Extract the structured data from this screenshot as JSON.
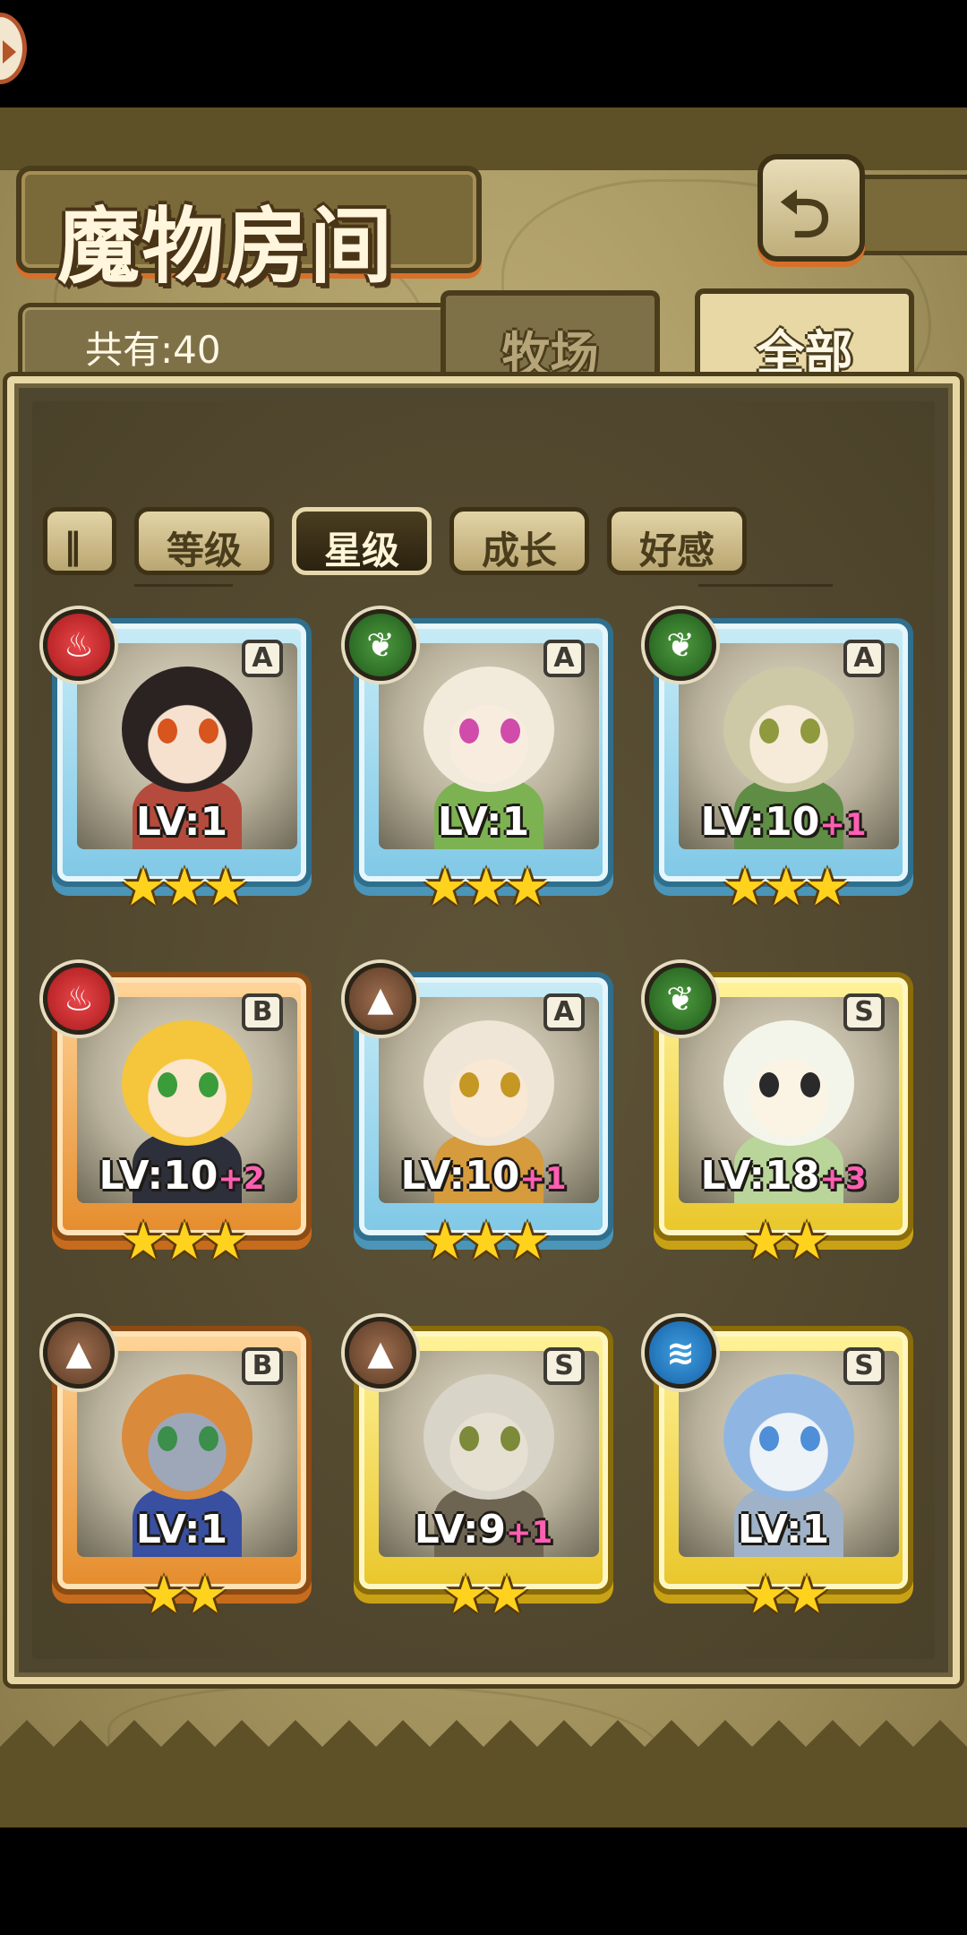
{
  "header": {
    "title": "魔物房间",
    "back_glyph": "⮌"
  },
  "tabs": {
    "count_label": "共有:40",
    "farm": "牧场",
    "all": "全部",
    "active": "全部"
  },
  "sort": {
    "toggle_glyph": "‖",
    "buttons": [
      "等级",
      "星级",
      "成长",
      "好感"
    ],
    "active": "星级"
  },
  "monsters": [
    {
      "rank": "A",
      "element": "fire",
      "level": "LV:1",
      "bonus": "",
      "stars": 3,
      "hair": "#2b2321",
      "skin": "#f6e1cf",
      "eyes": "#d8551d",
      "outfit": "#b54b3c"
    },
    {
      "rank": "A",
      "element": "leaf",
      "level": "LV:1",
      "bonus": "",
      "stars": 3,
      "hair": "#f2ebdc",
      "skin": "#f8ecdf",
      "eyes": "#d14caa",
      "outfit": "#7cb251"
    },
    {
      "rank": "A",
      "element": "leaf",
      "level": "LV:10",
      "bonus": "+1",
      "stars": 3,
      "hair": "#cdc8a6",
      "skin": "#f5ebd8",
      "eyes": "#8f9a3e",
      "outfit": "#5f8d45"
    },
    {
      "rank": "B",
      "element": "fire",
      "level": "LV:10",
      "bonus": "+2",
      "stars": 3,
      "hair": "#f5c53b",
      "skin": "#fbe6cc",
      "eyes": "#3b9c3a",
      "outfit": "#2d2f3a"
    },
    {
      "rank": "A",
      "element": "earth",
      "level": "LV:10",
      "bonus": "+1",
      "stars": 3,
      "hair": "#efe6d8",
      "skin": "#f8e8d4",
      "eyes": "#c59723",
      "outfit": "#d59b3d"
    },
    {
      "rank": "S",
      "element": "leaf",
      "level": "LV:18",
      "bonus": "+3",
      "stars": 2,
      "hair": "#f4f5ea",
      "skin": "#fbf3e4",
      "eyes": "#2a2a2a",
      "outfit": "#b9d59a"
    },
    {
      "rank": "B",
      "element": "earth",
      "level": "LV:1",
      "bonus": "",
      "stars": 2,
      "hair": "#d98a3a",
      "skin": "#9ea7b8",
      "eyes": "#3b8f4a",
      "outfit": "#394fa0"
    },
    {
      "rank": "S",
      "element": "earth",
      "level": "LV:9",
      "bonus": "+1",
      "stars": 2,
      "hair": "#d8d4c8",
      "skin": "#e6e0d2",
      "eyes": "#7c8a3a",
      "outfit": "#6e6452"
    },
    {
      "rank": "S",
      "element": "water",
      "level": "LV:1",
      "bonus": "",
      "stars": 2,
      "hair": "#8fb6e2",
      "skin": "#eef3f8",
      "eyes": "#4f8fd8",
      "outfit": "#9fb2c8"
    }
  ],
  "element_symbols": {
    "fire": "♨",
    "leaf": "❦",
    "earth": "▲",
    "water": "≋"
  },
  "colors": {
    "background_parchment": "#b3a26b",
    "panel_border": "#e7d7a4",
    "accent_orange": "#d6702a",
    "star_gold": "#ffd21e",
    "bonus_pink": "#ff5fb3"
  }
}
